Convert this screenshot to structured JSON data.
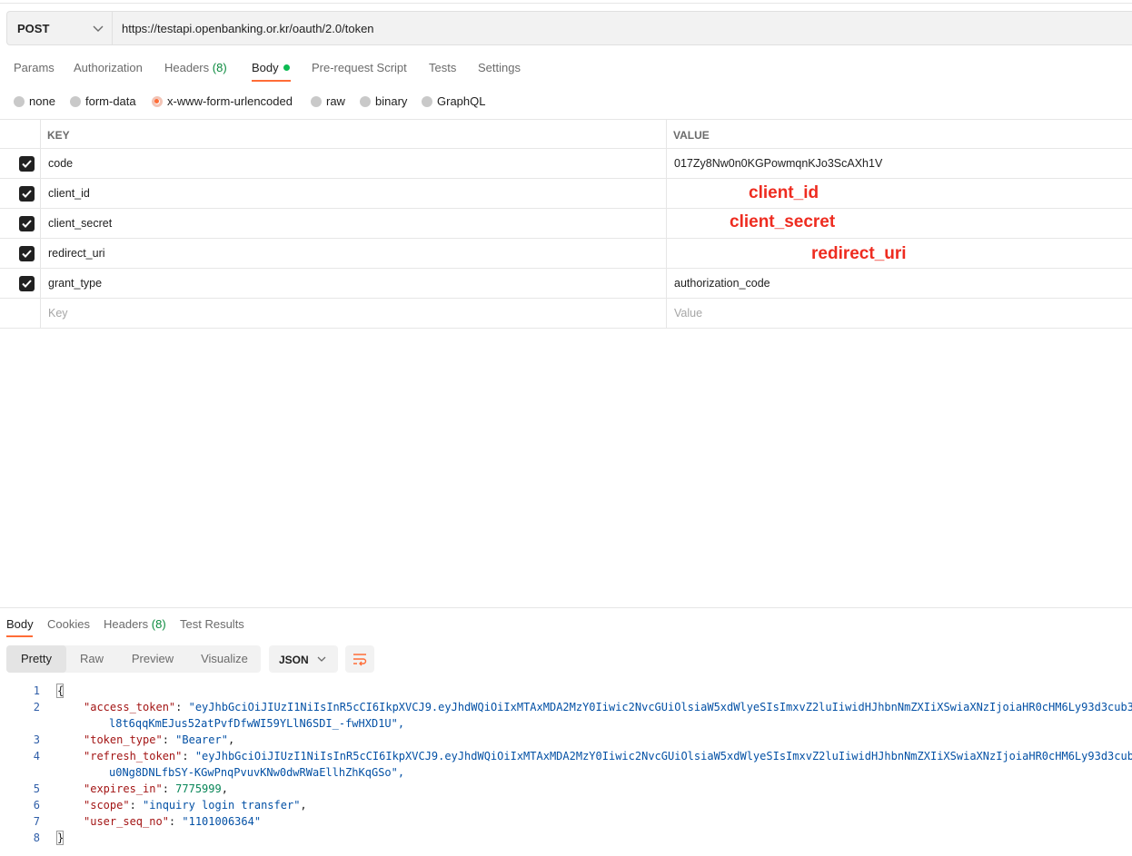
{
  "request": {
    "method": "POST",
    "url": "https://testapi.openbanking.or.kr/oauth/2.0/token"
  },
  "request_tabs": {
    "params": "Params",
    "authorization": "Authorization",
    "headers": "Headers",
    "headers_count": "(8)",
    "body": "Body",
    "pre_request": "Pre-request Script",
    "tests": "Tests",
    "settings": "Settings"
  },
  "body_types": {
    "none": "none",
    "form_data": "form-data",
    "urlencoded": "x-www-form-urlencoded",
    "raw": "raw",
    "binary": "binary",
    "graphql": "GraphQL",
    "selected": "x-www-form-urlencoded"
  },
  "params_table": {
    "key_header": "KEY",
    "value_header": "VALUE",
    "rows": [
      {
        "key": "code",
        "value": "017Zy8Nw0n0KGPowmqnKJo3ScAXh1V",
        "annotation": ""
      },
      {
        "key": "client_id",
        "value": "",
        "annotation": "client_id"
      },
      {
        "key": "client_secret",
        "value": "",
        "annotation": "client_secret"
      },
      {
        "key": "redirect_uri",
        "value": "",
        "annotation": "redirect_uri"
      },
      {
        "key": "grant_type",
        "value": "authorization_code",
        "annotation": ""
      }
    ],
    "key_placeholder": "Key",
    "value_placeholder": "Value"
  },
  "response_tabs": {
    "body": "Body",
    "cookies": "Cookies",
    "headers": "Headers",
    "headers_count": "(8)",
    "test_results": "Test Results"
  },
  "response_view": {
    "pretty": "Pretty",
    "raw": "Raw",
    "preview": "Preview",
    "visualize": "Visualize",
    "format": "JSON"
  },
  "response_body": {
    "line_numbers": [
      "1",
      "2",
      "3",
      "4",
      "5",
      "6",
      "7",
      "8"
    ],
    "open_brace": "{",
    "close_brace": "}",
    "access_token_key": "\"access_token\"",
    "access_token_value_1": "\"eyJhbGciOiJIUzI1NiIsInR5cCI6IkpXVCJ9.eyJhdWQiOiIxMTAxMDA2MzY0Iiwic2NvcGUiOlsiaW5xdWlyeSIsImxvZ2luIiwidHJhbnNmZXIiXSwiaXNzIjoiaHR0cHM6Ly93d3cub3",
    "access_token_value_2": "l8t6qqKmEJus52atPvfDfwWI59YLlN6SDI_-fwHXD1U\",",
    "token_type_key": "\"token_type\"",
    "token_type_value": "\"Bearer\"",
    "refresh_token_key": "\"refresh_token\"",
    "refresh_token_value_1": "\"eyJhbGciOiJIUzI1NiIsInR5cCI6IkpXVCJ9.eyJhdWQiOiIxMTAxMDA2MzY0Iiwic2NvcGUiOlsiaW5xdWlyeSIsImxvZ2luIiwidHJhbnNmZXIiXSwiaXNzIjoiaHR0cHM6Ly93d3cub",
    "refresh_token_value_2": "u0Ng8DNLfbSY-KGwPnqPvuvKNw0dwRWaEllhZhKqGSo\",",
    "expires_in_key": "\"expires_in\"",
    "expires_in_value": "7775999",
    "scope_key": "\"scope\"",
    "scope_value": "\"inquiry login transfer\"",
    "user_seq_no_key": "\"user_seq_no\"",
    "user_seq_no_value": "\"1101006364\""
  },
  "colors": {
    "accent": "#ff6c37",
    "annotation": "#ee2c20",
    "count_green": "#0b8a3e",
    "json_key": "#a31515",
    "json_string": "#0451a5",
    "json_number": "#098658"
  },
  "icons": {
    "method_dropdown": "chevron-down-icon",
    "format_dropdown": "chevron-down-icon",
    "wrap": "wrap-lines-icon",
    "checkbox": "check-icon"
  }
}
